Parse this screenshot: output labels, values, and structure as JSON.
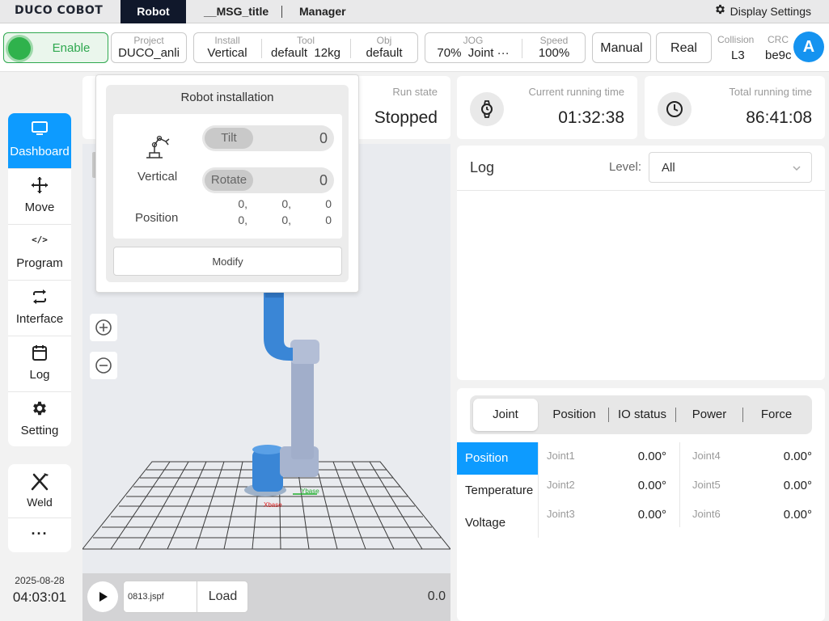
{
  "topbar": {
    "logo": "DUCO COBOT",
    "tabs": [
      {
        "label": "Robot"
      },
      {
        "label": "__MSG_title"
      },
      {
        "label": "Manager"
      }
    ],
    "display_settings": "Display Settings"
  },
  "statusbar": {
    "enable": "Enable",
    "project": {
      "label": "Project",
      "value": "DUCO_anli"
    },
    "install": {
      "label": "Install",
      "value": "Vertical"
    },
    "tool": {
      "label": "Tool",
      "value": "default",
      "weight": "12kg"
    },
    "obj": {
      "label": "Obj",
      "value": "default"
    },
    "jog": {
      "label": "JOG",
      "value": "70%",
      "mode": "Joint ···"
    },
    "speed": {
      "label": "Speed",
      "value": "100%"
    },
    "manual": "Manual",
    "real": "Real",
    "collision": {
      "label": "Collision",
      "value": "L3"
    },
    "crc": {
      "label": "CRC",
      "value": "be9c"
    },
    "avatar": "A"
  },
  "sidebar": {
    "items": [
      {
        "label": "Dashboard"
      },
      {
        "label": "Move"
      },
      {
        "label": "Program"
      },
      {
        "label": "Interface"
      },
      {
        "label": "Log"
      },
      {
        "label": "Setting"
      }
    ],
    "weld": "Weld",
    "more": "···",
    "date": "2025-08-28",
    "time": "04:03:01"
  },
  "cards": {
    "run_state": {
      "label": "Run state",
      "value": "Stopped"
    },
    "current": {
      "label": "Current running time",
      "value": "01:32:38"
    },
    "total": {
      "label": "Total running time",
      "value": "86:41:08"
    }
  },
  "popup": {
    "title": "Robot installation",
    "mount": "Vertical",
    "tilt": {
      "label": "Tilt",
      "value": "0"
    },
    "rotate": {
      "label": "Rotate",
      "value": "0"
    },
    "position_label": "Position",
    "position_rows": [
      [
        "0,",
        "0,",
        "0"
      ],
      [
        "0,",
        "0,",
        "0"
      ]
    ],
    "modify": "Modify"
  },
  "viewport": {
    "axis_x": "Xbase",
    "axis_y": "Ybase",
    "program_file": "0813.jspf",
    "load": "Load",
    "speed": "0.0"
  },
  "log": {
    "title": "Log",
    "level_label": "Level:",
    "level_value": "All"
  },
  "joint_panel": {
    "tabs": [
      {
        "label": "Joint"
      },
      {
        "label": "Position"
      },
      {
        "label": "IO status"
      },
      {
        "label": "Power"
      },
      {
        "label": "Force"
      }
    ],
    "subtabs": [
      {
        "label": "Position"
      },
      {
        "label": "Temperature"
      },
      {
        "label": "Voltage"
      }
    ],
    "joints": [
      {
        "name": "Joint1",
        "value": "0.00°"
      },
      {
        "name": "Joint2",
        "value": "0.00°"
      },
      {
        "name": "Joint3",
        "value": "0.00°"
      },
      {
        "name": "Joint4",
        "value": "0.00°"
      },
      {
        "name": "Joint5",
        "value": "0.00°"
      },
      {
        "name": "Joint6",
        "value": "0.00°"
      }
    ]
  },
  "colors": {
    "accent": "#0d9bff",
    "enable_green": "#2fb24c",
    "robot_blue": "#3a86d6",
    "nav_dark": "#10182b"
  }
}
